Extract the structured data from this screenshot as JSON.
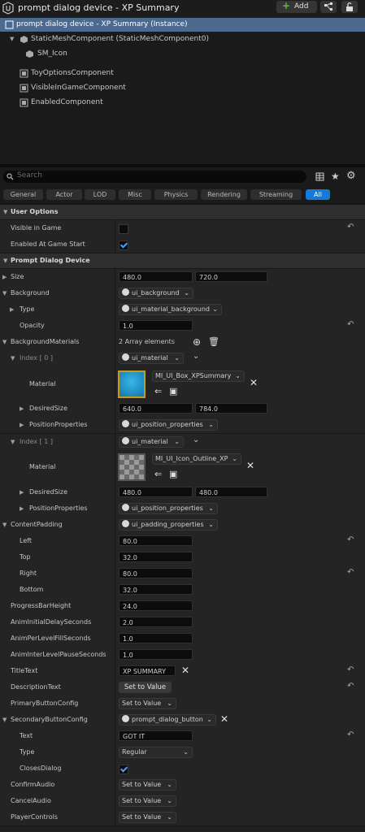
{
  "titlebar": {
    "title": "prompt dialog device - XP Summary",
    "add_label": "Add"
  },
  "tree": {
    "items": [
      {
        "label": "prompt dialog device - XP Summary (Instance)"
      },
      {
        "label": "StaticMeshComponent (StaticMeshComponent0)"
      },
      {
        "label": "SM_Icon"
      },
      {
        "label": "ToyOptionsComponent"
      },
      {
        "label": "VisibleInGameComponent"
      },
      {
        "label": "EnabledComponent"
      }
    ]
  },
  "search": {
    "placeholder": "Search"
  },
  "tabs": [
    "General",
    "Actor",
    "LOD",
    "Misc",
    "Physics",
    "Rendering",
    "Streaming",
    "All"
  ],
  "cats": {
    "user_options": "User Options",
    "prompt_dialog": "Prompt Dialog Device"
  },
  "props": {
    "visible_in_game": "Visible in Game",
    "enabled_at_start": "Enabled At Game Start",
    "size": {
      "label": "Size",
      "x": "480.0",
      "y": "720.0"
    },
    "background": {
      "label": "Background",
      "value": "ui_background"
    },
    "type": {
      "label": "Type",
      "value": "ui_material_background"
    },
    "opacity": {
      "label": "Opacity",
      "value": "1.0"
    },
    "bg_materials": {
      "label": "BackgroundMaterials",
      "value": "2 Array elements"
    },
    "index0": {
      "label": "Index [ 0 ]",
      "value": "ui_material"
    },
    "material0": {
      "label": "Material",
      "value": "MI_UI_Box_XPSummary"
    },
    "desired0": {
      "label": "DesiredSize",
      "x": "640.0",
      "y": "784.0"
    },
    "pos0": {
      "label": "PositionProperties",
      "value": "ui_position_properties"
    },
    "index1": {
      "label": "Index [ 1 ]",
      "value": "ui_material"
    },
    "material1": {
      "label": "Material",
      "value": "MI_UI_Icon_Outline_XP"
    },
    "desired1": {
      "label": "DesiredSize",
      "x": "480.0",
      "y": "480.0"
    },
    "pos1": {
      "label": "PositionProperties",
      "value": "ui_position_properties"
    },
    "content_padding": {
      "label": "ContentPadding",
      "value": "ui_padding_properties"
    },
    "left": {
      "label": "Left",
      "value": "80.0"
    },
    "top": {
      "label": "Top",
      "value": "32.0"
    },
    "right": {
      "label": "Right",
      "value": "80.0"
    },
    "bottom": {
      "label": "Bottom",
      "value": "32.0"
    },
    "progress_h": {
      "label": "ProgressBarHeight",
      "value": "24.0"
    },
    "anim_delay": {
      "label": "AnimInitialDelaySeconds",
      "value": "2.0"
    },
    "anim_fill": {
      "label": "AnimPerLevelFillSeconds",
      "value": "1.0"
    },
    "anim_pause": {
      "label": "AnimInterLevelPauseSeconds",
      "value": "1.0"
    },
    "title_text": {
      "label": "TitleText",
      "value": "XP SUMMARY"
    },
    "desc_text": {
      "label": "DescriptionText",
      "value": "Set to Value"
    },
    "primary_btn": {
      "label": "PrimaryButtonConfig",
      "value": "Set to Value"
    },
    "secondary_btn": {
      "label": "SecondaryButtonConfig",
      "value": "prompt_dialog_button"
    },
    "text": {
      "label": "Text",
      "value": "GOT IT"
    },
    "btn_type": {
      "label": "Type",
      "value": "Regular"
    },
    "closes": {
      "label": "ClosesDialog"
    },
    "confirm_audio": {
      "label": "ConfirmAudio",
      "value": "Set to Value"
    },
    "cancel_audio": {
      "label": "CancelAudio",
      "value": "Set to Value"
    },
    "player_controls": {
      "label": "PlayerControls",
      "value": "Set to Value"
    }
  },
  "colors": {
    "selection": "#4b6a8e",
    "accent": "#1479d8",
    "checkbox": "#4a9eff",
    "add_plus": "#5bbd3a"
  },
  "icons": [
    "ue-logo-icon",
    "plus-icon",
    "blueprint-icon",
    "lock-icon",
    "mesh-icon",
    "component-icon",
    "search-icon",
    "table-icon",
    "star-icon",
    "gear-icon",
    "reset-icon",
    "close-icon",
    "add-icon",
    "trash-icon",
    "browse-icon",
    "use-selected-icon"
  ]
}
